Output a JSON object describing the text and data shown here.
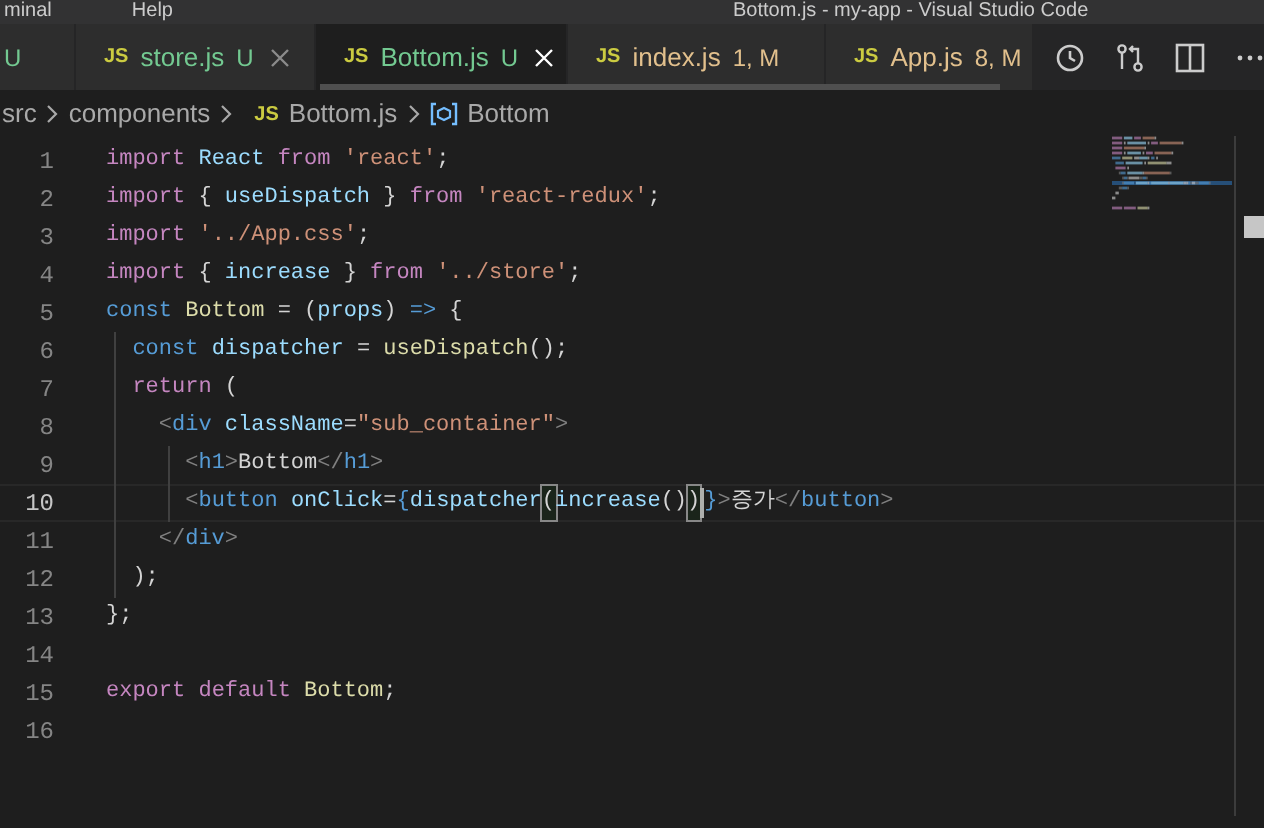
{
  "title_bar": {
    "menu": [
      "minal",
      "Help"
    ],
    "title": "Bottom.js - my-app - Visual Studio Code"
  },
  "tabs": [
    {
      "status": "U",
      "color": "#73c991",
      "selected": false,
      "close_visible": false
    },
    {
      "icon_text": "JS",
      "label": "store.js",
      "status": "U",
      "color": "#73c991",
      "selected": false,
      "close_visible": true
    },
    {
      "icon_text": "JS",
      "label": "Bottom.js",
      "status": "U",
      "color": "#73c991",
      "selected": true,
      "close_visible": true
    },
    {
      "icon_text": "JS",
      "label": "index.js",
      "status": "1, M",
      "color": "#e2c08d",
      "selected": false,
      "close_visible": false
    },
    {
      "icon_text": "JS",
      "label": "App.js",
      "status": "8, M",
      "color": "#e2c08d",
      "selected": false,
      "close_visible": false
    }
  ],
  "breadcrumbs": [
    {
      "kind": "folder",
      "label": "src"
    },
    {
      "kind": "folder",
      "label": "components"
    },
    {
      "kind": "file",
      "icon_text": "JS",
      "label": "Bottom.js"
    },
    {
      "kind": "symbol",
      "label": "Bottom"
    }
  ],
  "lines": [
    {
      "number": "1",
      "active": false,
      "tokens": [
        {
          "kind": "keyword",
          "text": "import "
        },
        {
          "kind": "variable",
          "text": "React "
        },
        {
          "kind": "keyword",
          "text": "from "
        },
        {
          "kind": "string",
          "text": "'react'"
        },
        {
          "kind": "plain",
          "text": ";"
        }
      ]
    },
    {
      "number": "2",
      "active": false,
      "tokens": [
        {
          "kind": "keyword",
          "text": "import "
        },
        {
          "kind": "plain",
          "text": "{ "
        },
        {
          "kind": "variable",
          "text": "useDispatch "
        },
        {
          "kind": "plain",
          "text": "} "
        },
        {
          "kind": "keyword",
          "text": "from "
        },
        {
          "kind": "string",
          "text": "'react-redux'"
        },
        {
          "kind": "plain",
          "text": ";"
        }
      ]
    },
    {
      "number": "3",
      "active": false,
      "tokens": [
        {
          "kind": "keyword",
          "text": "import "
        },
        {
          "kind": "string",
          "text": "'../App.css'"
        },
        {
          "kind": "plain",
          "text": ";"
        }
      ]
    },
    {
      "number": "4",
      "active": false,
      "tokens": [
        {
          "kind": "keyword",
          "text": "import "
        },
        {
          "kind": "plain",
          "text": "{ "
        },
        {
          "kind": "variable",
          "text": "increase "
        },
        {
          "kind": "plain",
          "text": "} "
        },
        {
          "kind": "keyword",
          "text": "from "
        },
        {
          "kind": "string",
          "text": "'../store'"
        },
        {
          "kind": "plain",
          "text": ";"
        }
      ]
    },
    {
      "number": "5",
      "active": false,
      "tokens": [
        {
          "kind": "storage",
          "text": "const "
        },
        {
          "kind": "function",
          "text": "Bottom "
        },
        {
          "kind": "plain",
          "text": "= ("
        },
        {
          "kind": "variable",
          "text": "props"
        },
        {
          "kind": "plain",
          "text": ") "
        },
        {
          "kind": "storage",
          "text": "=> "
        },
        {
          "kind": "plain",
          "text": "{"
        }
      ]
    },
    {
      "number": "6",
      "active": false,
      "tokens": [
        {
          "kind": "storage",
          "text": "  const "
        },
        {
          "kind": "variable",
          "text": "dispatcher "
        },
        {
          "kind": "plain",
          "text": "= "
        },
        {
          "kind": "function",
          "text": "useDispatch"
        },
        {
          "kind": "plain",
          "text": "();"
        }
      ]
    },
    {
      "number": "7",
      "active": false,
      "tokens": [
        {
          "kind": "keyword",
          "text": "  return "
        },
        {
          "kind": "plain",
          "text": "("
        }
      ]
    },
    {
      "number": "8",
      "active": false,
      "tokens": [
        {
          "kind": "tag_punct",
          "text": "    <"
        },
        {
          "kind": "tag",
          "text": "div "
        },
        {
          "kind": "variable",
          "text": "className"
        },
        {
          "kind": "plain",
          "text": "="
        },
        {
          "kind": "string",
          "text": "\"sub_container\""
        },
        {
          "kind": "tag_punct",
          "text": ">"
        }
      ]
    },
    {
      "number": "9",
      "active": false,
      "tokens": [
        {
          "kind": "tag_punct",
          "text": "      <"
        },
        {
          "kind": "tag",
          "text": "h1"
        },
        {
          "kind": "tag_punct",
          "text": ">"
        },
        {
          "kind": "plain",
          "text": "Bottom"
        },
        {
          "kind": "tag_punct",
          "text": "</"
        },
        {
          "kind": "tag",
          "text": "h1"
        },
        {
          "kind": "tag_punct",
          "text": ">"
        }
      ]
    },
    {
      "number": "10",
      "active": true,
      "tokens": [
        {
          "kind": "tag_punct",
          "text": "      <"
        },
        {
          "kind": "tag",
          "text": "button "
        },
        {
          "kind": "variable",
          "text": "onClick"
        },
        {
          "kind": "plain",
          "text": "="
        },
        {
          "kind": "storage",
          "text": "{"
        },
        {
          "kind": "variable",
          "text": "dispatcher"
        },
        {
          "kind": "bracket_match",
          "text": "("
        },
        {
          "kind": "variable",
          "text": "increase"
        },
        {
          "kind": "plain",
          "text": "()"
        },
        {
          "kind": "bracket_match",
          "text": ")"
        },
        {
          "kind": "cursor"
        },
        {
          "kind": "storage",
          "text": "}"
        },
        {
          "kind": "tag_punct",
          "text": ">"
        },
        {
          "kind": "plain",
          "text": "증가"
        },
        {
          "kind": "tag_punct",
          "text": "</"
        },
        {
          "kind": "tag",
          "text": "button"
        },
        {
          "kind": "tag_punct",
          "text": ">"
        }
      ]
    },
    {
      "number": "11",
      "active": false,
      "tokens": [
        {
          "kind": "tag_punct",
          "text": "    </"
        },
        {
          "kind": "tag",
          "text": "div"
        },
        {
          "kind": "tag_punct",
          "text": ">"
        }
      ]
    },
    {
      "number": "12",
      "active": false,
      "tokens": [
        {
          "kind": "plain",
          "text": "  );"
        }
      ]
    },
    {
      "number": "13",
      "active": false,
      "tokens": [
        {
          "kind": "plain",
          "text": "};"
        }
      ]
    },
    {
      "number": "14",
      "active": false
    },
    {
      "number": "15",
      "active": false,
      "tokens": [
        {
          "kind": "keyword",
          "text": "export "
        },
        {
          "kind": "keyword",
          "text": "default "
        },
        {
          "kind": "function",
          "text": "Bottom"
        },
        {
          "kind": "plain",
          "text": ";"
        }
      ]
    },
    {
      "number": "16",
      "active": false
    }
  ]
}
